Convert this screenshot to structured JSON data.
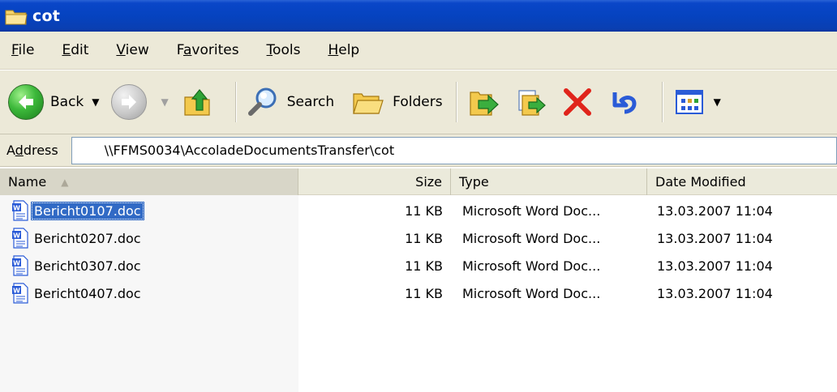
{
  "window": {
    "title": "cot"
  },
  "menu": {
    "items": [
      {
        "first": "F",
        "rest": "ile"
      },
      {
        "first": "E",
        "rest": "dit"
      },
      {
        "first": "V",
        "rest": "iew"
      },
      {
        "pre": "F",
        "first": "a",
        "rest": "vorites"
      },
      {
        "first": "T",
        "rest": "ools"
      },
      {
        "first": "H",
        "rest": "elp"
      }
    ]
  },
  "toolbar": {
    "back_label": "Back",
    "search_label": "Search",
    "folders_label": "Folders"
  },
  "address": {
    "label_pre": "A",
    "label_u": "d",
    "label_post": "dress",
    "value": "\\\\FFMS0034\\AccoladeDocumentsTransfer\\cot"
  },
  "columns": {
    "name": "Name",
    "size": "Size",
    "type": "Type",
    "date": "Date Modified"
  },
  "files": [
    {
      "name": "Bericht0107.doc",
      "size": "11 KB",
      "type": "Microsoft Word Doc...",
      "date": "13.03.2007 11:04",
      "selected": true
    },
    {
      "name": "Bericht0207.doc",
      "size": "11 KB",
      "type": "Microsoft Word Doc...",
      "date": "13.03.2007 11:04",
      "selected": false
    },
    {
      "name": "Bericht0307.doc",
      "size": "11 KB",
      "type": "Microsoft Word Doc...",
      "date": "13.03.2007 11:04",
      "selected": false
    },
    {
      "name": "Bericht0407.doc",
      "size": "11 KB",
      "type": "Microsoft Word Doc...",
      "date": "13.03.2007 11:04",
      "selected": false
    }
  ],
  "colors": {
    "titlebar": "#0543c0",
    "selection": "#316ac5",
    "chrome": "#ece9d8",
    "delete": "#e0241b"
  },
  "icons": [
    "folder-icon",
    "back-arrow-icon",
    "forward-arrow-icon",
    "up-folder-icon",
    "search-magnifier-icon",
    "folders-icon",
    "move-to-icon",
    "copy-to-icon",
    "delete-x-icon",
    "undo-icon",
    "views-icon",
    "word-document-icon"
  ]
}
